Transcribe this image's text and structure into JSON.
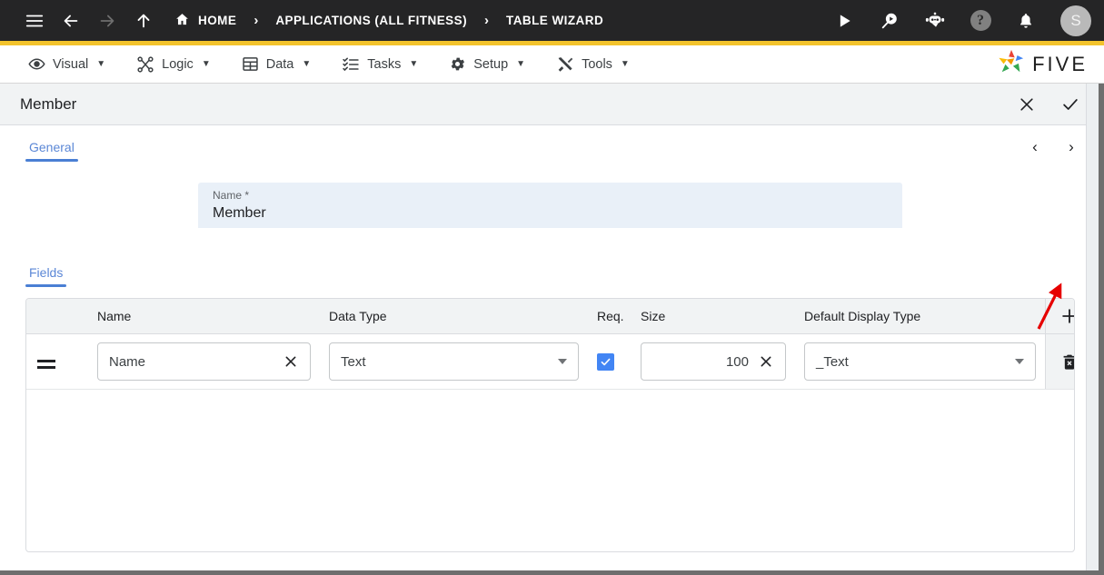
{
  "topbar": {
    "menu_icon": "hamburger-menu-icon",
    "back_icon": "arrow-back-icon",
    "forward_icon": "arrow-forward-icon",
    "up_icon": "arrow-up-icon",
    "breadcrumbs": [
      {
        "label": "HOME",
        "icon": "home-icon"
      },
      {
        "label": "APPLICATIONS (ALL FITNESS)",
        "icon": ""
      },
      {
        "label": "TABLE WIZARD",
        "icon": ""
      }
    ],
    "separator": "›",
    "actions": [
      {
        "name": "run-icon",
        "label": ""
      },
      {
        "name": "search-play-icon",
        "label": ""
      },
      {
        "name": "chatbot-icon",
        "label": ""
      },
      {
        "name": "help-icon",
        "label": "?"
      },
      {
        "name": "notifications-bell-icon",
        "label": ""
      }
    ],
    "avatar_initial": "S",
    "accent_color": "#f3c32c",
    "bar_color": "#252526"
  },
  "menubar": {
    "items": [
      {
        "label": "Visual",
        "icon": "eye-icon",
        "caret": "▼"
      },
      {
        "label": "Logic",
        "icon": "logic-nodes-icon",
        "caret": "▼"
      },
      {
        "label": "Data",
        "icon": "table-grid-icon",
        "caret": "▼"
      },
      {
        "label": "Tasks",
        "icon": "checklist-icon",
        "caret": "▼"
      },
      {
        "label": "Setup",
        "icon": "gear-icon",
        "caret": "▼"
      },
      {
        "label": "Tools",
        "icon": "tools-icon",
        "caret": "▼"
      }
    ],
    "brand": {
      "text": "FIVE",
      "logo_icon": "five-pinwheel-logo"
    }
  },
  "dialog": {
    "title": "Member",
    "close_label": "✕",
    "confirm_label": "✓",
    "tabs": [
      {
        "label": "General",
        "active": true
      }
    ],
    "pager": {
      "prev": "‹",
      "next": "›"
    },
    "name_field": {
      "label": "Name *",
      "value": "Member",
      "placeholder": "Name"
    },
    "fields_section": {
      "tab_label": "Fields",
      "columns": [
        "",
        "Name",
        "Data Type",
        "Req.",
        "Size",
        "Default Display Type",
        ""
      ],
      "add_label": "+",
      "rows": [
        {
          "handle": "drag-handle-icon",
          "name": "Name",
          "name_clear": "✕",
          "data_type": "Text",
          "required": true,
          "size": "100",
          "size_clear": "✕",
          "default_display_type": "_Text",
          "delete_label": "delete-row"
        }
      ]
    }
  },
  "annotation": {
    "arrow_color": "#e60000",
    "points_to": "next-page-button"
  }
}
